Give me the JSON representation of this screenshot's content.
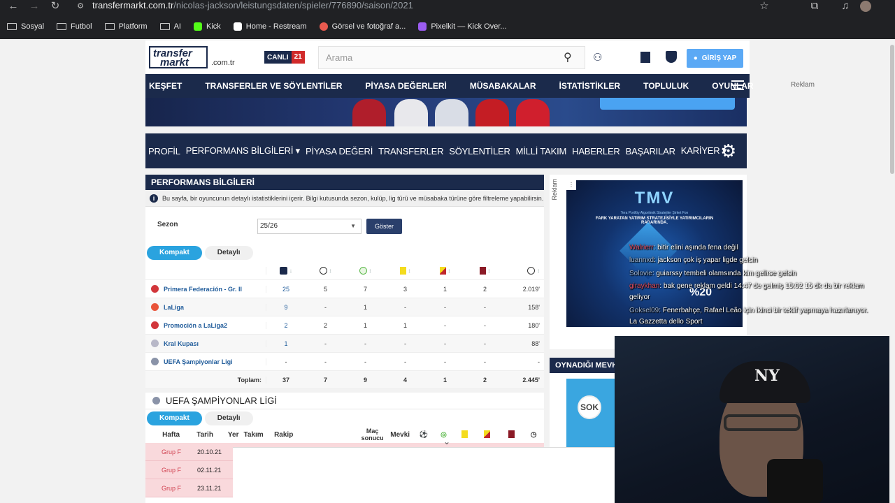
{
  "browser": {
    "url_host": "transfermarkt.com.tr",
    "url_path": "/nicolas-jackson/leistungsdaten/spieler/776890/saison/2021",
    "bookmarks": [
      {
        "label": "Sosyal",
        "icon": "folder-icon"
      },
      {
        "label": "Futbol",
        "icon": "folder-icon"
      },
      {
        "label": "Platform",
        "icon": "folder-icon"
      },
      {
        "label": "AI",
        "icon": "folder-icon"
      },
      {
        "label": "Kick",
        "icon": "kick-icon",
        "color": "#53fc18"
      },
      {
        "label": "Home - Restream",
        "icon": "restream-icon",
        "color": "#ffffff"
      },
      {
        "label": "Görsel ve fotoğraf a...",
        "icon": "image-tool-icon",
        "color": "#e85a4f"
      },
      {
        "label": "Pixelkit — Kick Over...",
        "icon": "pixelkit-icon",
        "color": "#9b5cf0"
      }
    ]
  },
  "site": {
    "logo_line1": "transfer",
    "logo_line2": "markt",
    "logo_tld": ".com.tr",
    "live_label": "CANLI",
    "live_count": "21",
    "search_placeholder": "Arama",
    "login_label": "GİRİŞ YAP",
    "main_nav": [
      "KEŞFET",
      "TRANSFERLER VE SÖYLENTİLER",
      "PİYASA DEĞERLERİ",
      "MÜSABAKALAR",
      "İSTATİSTİKLER",
      "TOPLULUK",
      "OYUNLAR"
    ],
    "sub_nav": [
      "PROFİL",
      "PERFORMANS BİLGİLERİ ▾",
      "PİYASA DEĞERİ",
      "TRANSFERLER",
      "SÖYLENTİLER",
      "MİLLİ TAKIM",
      "HABERLER",
      "BAŞARILAR",
      "KARİYER ▾"
    ],
    "right_ad_label": "Reklam"
  },
  "performance": {
    "title": "PERFORMANS BİLGİLERİ",
    "info": "Bu sayfa, bir oyuncunun detaylı istatistiklerini içerir. Bilgi kutusunda sezon, kulüp, lig türü ve müsabaka türüne göre filtreleme yapabilirsin. \"De...",
    "season_label": "Sezon",
    "season_value": "25/26",
    "show_button": "Göster",
    "tabs": [
      "Kompakt",
      "Detaylı"
    ],
    "rows": [
      {
        "competition": "Primera Federación - Gr. II",
        "icon_color": "#d2363b",
        "apps": "25",
        "goals": "5",
        "assists": "7",
        "yellow": "3",
        "second_yellow": "1",
        "red": "2",
        "minutes": "2.019'"
      },
      {
        "competition": "LaLiga",
        "icon_color": "#e9543a",
        "apps": "9",
        "goals": "-",
        "assists": "1",
        "yellow": "-",
        "second_yellow": "-",
        "red": "-",
        "minutes": "158'"
      },
      {
        "competition": "Promoción a LaLiga2",
        "icon_color": "#d2363b",
        "apps": "2",
        "goals": "2",
        "assists": "1",
        "yellow": "1",
        "second_yellow": "-",
        "red": "-",
        "minutes": "180'"
      },
      {
        "competition": "Kral Kupası",
        "icon_color": "#b8b8c8",
        "apps": "1",
        "goals": "-",
        "assists": "-",
        "yellow": "-",
        "second_yellow": "-",
        "red": "-",
        "minutes": "88'"
      },
      {
        "competition": "UEFA Şampiyonlar Ligi",
        "icon_color": "#8a93a8",
        "apps": "-",
        "goals": "-",
        "assists": "-",
        "yellow": "-",
        "second_yellow": "-",
        "red": "-",
        "minutes": "-"
      }
    ],
    "total": {
      "label": "Toplam:",
      "apps": "37",
      "goals": "7",
      "assists": "9",
      "yellow": "4",
      "second_yellow": "1",
      "red": "2",
      "minutes": "2.445'"
    }
  },
  "champions_league": {
    "title": "UEFA ŞAMPİYONLAR LİGİ",
    "tabs": [
      "Kompakt",
      "Detaylı"
    ],
    "headers": [
      "Hafta",
      "Tarih",
      "Yer",
      "Takım",
      "Rakip",
      "Maç sonucu",
      "Mevki"
    ],
    "rows": [
      {
        "week": "Grup F",
        "date": "20.10.21"
      },
      {
        "week": "Grup F",
        "date": "02.11.21"
      },
      {
        "week": "Grup F",
        "date": "23.11.21"
      }
    ]
  },
  "ad": {
    "label": "Reklam",
    "brand": "TMV",
    "subtitle": "Tera Portföy Algoritmik Stratejiler Şirket Fon",
    "tagline": "FARK YARATAN YATIRIM STRATEJİSİYLE YATIRIMCILARIN RADARINDA.",
    "percent": "%20"
  },
  "position_box": {
    "title": "OYNADIĞI MEVKİLER",
    "badge": "SOK"
  },
  "chat": [
    {
      "user": "Walrierr",
      "text": ": bitir elini aşında fena değil"
    },
    {
      "user": "luannxd",
      "text": ": jackson çok iş yapar ligde gelsin"
    },
    {
      "user": "Solovie",
      "text": ": guiarssy tembeli olamsında kim gelirse gelsin"
    },
    {
      "user": "giraykhan",
      "text": ": bak gene reklam geldi 14:47 de gelmiş 15:02 15 dk da bir reklam"
    },
    {
      "user": "",
      "text": "geliyor"
    },
    {
      "user": "Goksel09",
      "text": ": Fenerbahçe, Rafael Leão için ikinci bir teklif yapmaya hazırlanıyor."
    },
    {
      "user": "",
      "text": "La Gazzetta dello Sport"
    }
  ]
}
